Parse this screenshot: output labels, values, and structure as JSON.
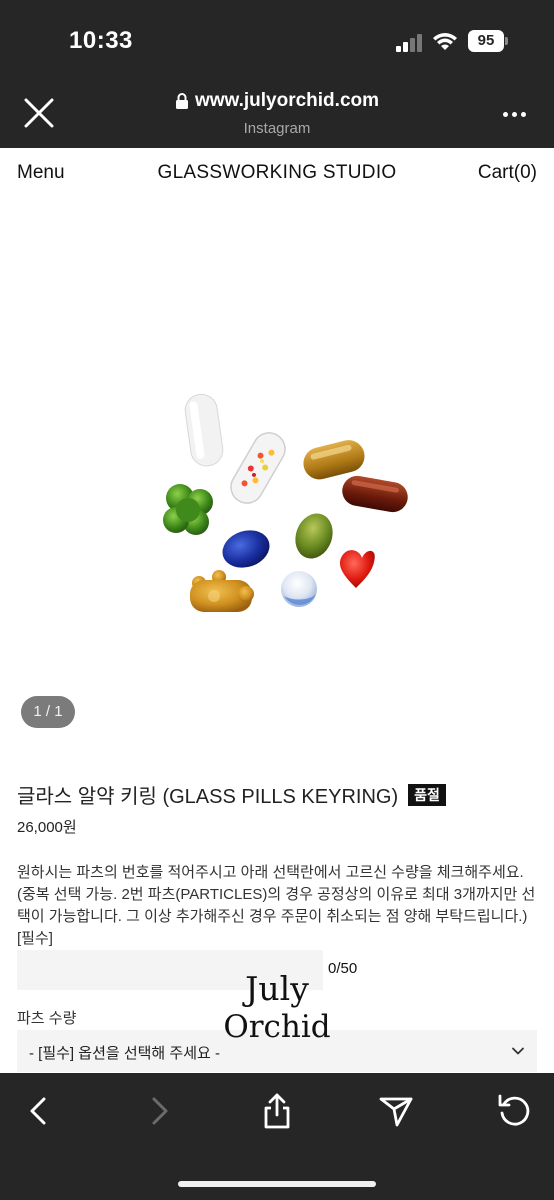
{
  "status_bar": {
    "time": "10:33",
    "battery": "95"
  },
  "browser": {
    "url": "www.julyorchid.com",
    "source": "Instagram",
    "close_icon": "close-icon",
    "more_icon": "more-horizontal-icon"
  },
  "site_nav": {
    "menu": "Menu",
    "title": "GLASSWORKING STUDIO",
    "cart": "Cart(0)"
  },
  "gallery": {
    "pager": "1 / 1"
  },
  "product": {
    "title": "글라스 알약 키링 (GLASS PILLS KEYRING)",
    "badge": "품절",
    "price": "26,000원",
    "description": "원하시는 파츠의 번호를 적어주시고 아래 선택란에서 고르신 수량을 체크해주세요. (중복 선택 가능. 2번 파츠(PARTICLES)의 경우 공정상의 이유로 최대 3개까지만 선택이 가능합니다. 그 이상 추가해주신 경우 주문이 취소되는 점 양해 부탁드립니다.)[필수]",
    "input_value": "",
    "char_count": "0/50",
    "option_label": "파츠 수량",
    "select_value": "- [필수] 옵션을 선택해 주세요 -"
  },
  "watermark": {
    "line1": "July",
    "line2": "Orchid"
  },
  "toolbar": {
    "back_icon": "chevron-left-icon",
    "forward_icon": "chevron-right-icon",
    "share_icon": "share-icon",
    "send_icon": "send-icon",
    "reload_icon": "reload-icon"
  },
  "colors": {
    "chrome": "#262626",
    "badge_bg": "#111111",
    "input_bg": "#f4f4f4"
  }
}
